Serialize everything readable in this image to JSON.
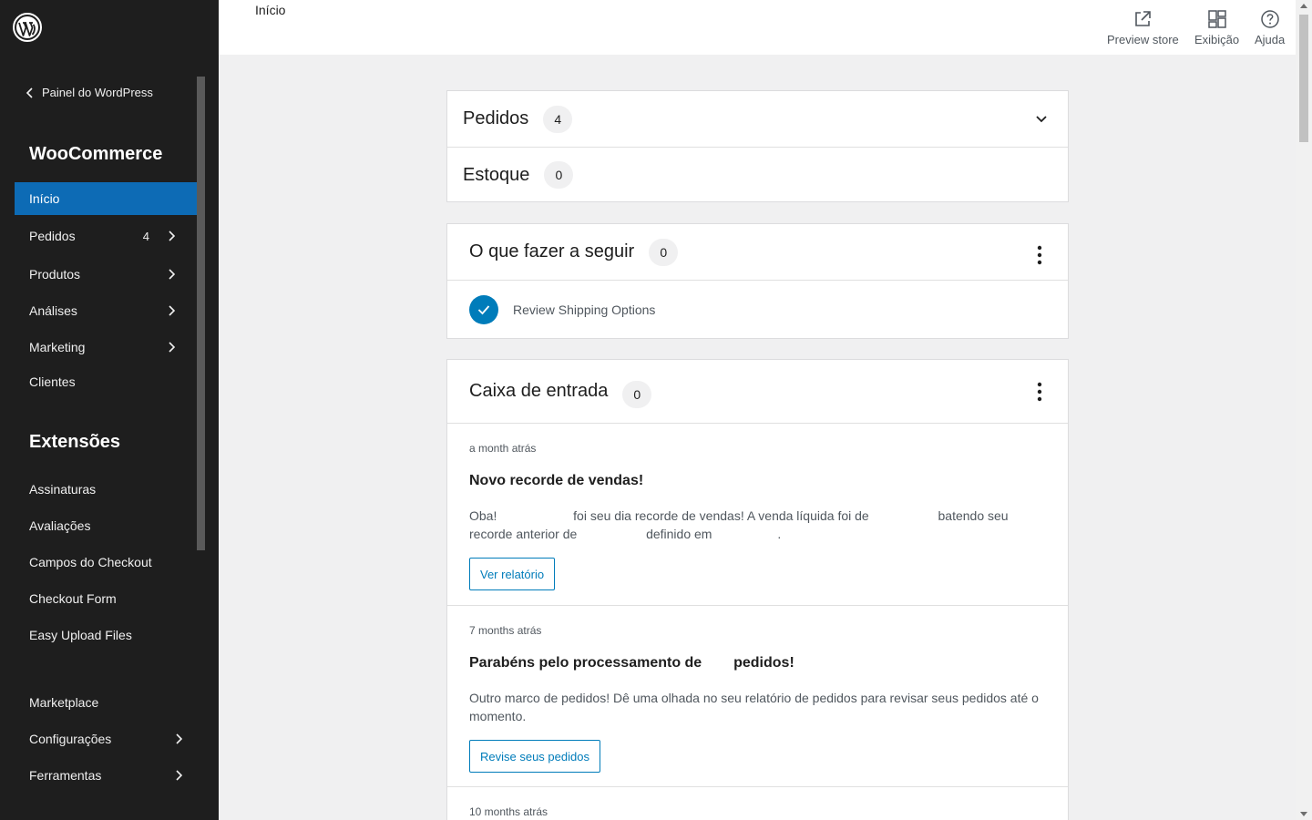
{
  "sidebar": {
    "back_label": "Painel do WordPress",
    "woo_title": "WooCommerce",
    "items": [
      {
        "label": "Início",
        "active": true
      },
      {
        "label": "Pedidos",
        "count": "4",
        "has_submenu": true
      },
      {
        "label": "Produtos",
        "has_submenu": true
      },
      {
        "label": "Análises",
        "has_submenu": true
      },
      {
        "label": "Marketing",
        "has_submenu": true
      },
      {
        "label": "Clientes"
      }
    ],
    "ext_title": "Extensões",
    "ext_items": [
      {
        "label": "Assinaturas"
      },
      {
        "label": "Avaliações"
      },
      {
        "label": "Campos do Checkout"
      },
      {
        "label": "Checkout Form"
      },
      {
        "label": "Easy Upload Files"
      }
    ],
    "bottom_items": [
      {
        "label": "Marketplace"
      },
      {
        "label": "Configurações",
        "has_submenu": true
      },
      {
        "label": "Ferramentas",
        "has_submenu": true
      }
    ],
    "accent_color": "#0d6bb5"
  },
  "topbar": {
    "breadcrumb": "Início",
    "actions": [
      {
        "label": "Preview store",
        "icon": "external-link-icon"
      },
      {
        "label": "Exibição",
        "icon": "layout-icon"
      },
      {
        "label": "Ajuda",
        "icon": "help-icon"
      }
    ]
  },
  "stats": {
    "orders_label": "Pedidos",
    "orders_count": "4",
    "stock_label": "Estoque",
    "stock_count": "0"
  },
  "tasks": {
    "title": "O que fazer a seguir",
    "count": "0",
    "items": [
      {
        "label": "Review Shipping Options",
        "done": true
      }
    ]
  },
  "inbox": {
    "title": "Caixa de entrada",
    "count": "0",
    "notes": [
      {
        "date": "a month atrás",
        "title": "Novo recorde de vendas!",
        "body_parts": [
          "Oba!",
          "foi seu dia recorde de vendas! A venda líquida foi de",
          "batendo seu recorde",
          "anterior de",
          "definido em",
          "."
        ],
        "button": "Ver relatório"
      },
      {
        "date": "7 months atrás",
        "title_parts": [
          "Parabéns pelo processamento de",
          "pedidos!"
        ],
        "body": "Outro marco de pedidos! Dê uma olhada no seu relatório de pedidos para revisar seus pedidos até o momento.",
        "button": "Revise seus pedidos"
      },
      {
        "date": "10 months atrás"
      }
    ]
  },
  "colors": {
    "primary": "#007cba",
    "sidebar_bg": "#1e1e1e"
  }
}
